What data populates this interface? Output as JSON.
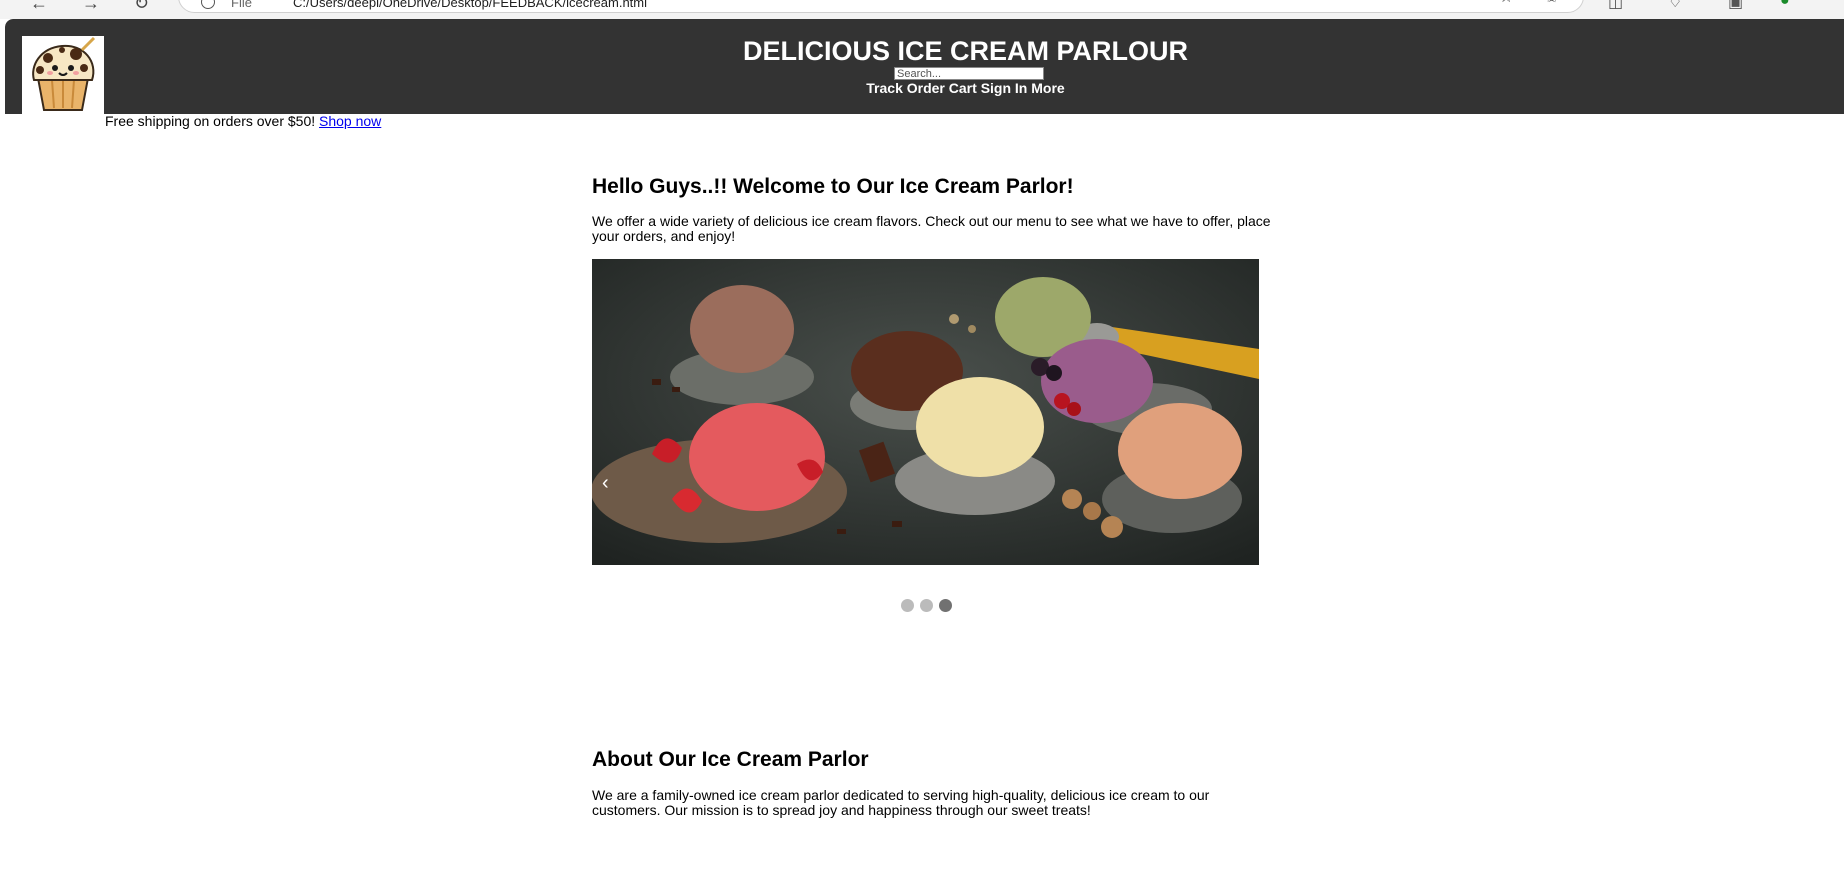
{
  "browser": {
    "address_scheme": "File",
    "address_url": "C:/Users/deepi/OneDrive/Desktop/FEEDBACK/icecream.html",
    "icons": [
      "back-icon",
      "forward-icon",
      "refresh-icon",
      "site-info-icon",
      "zoom-icon",
      "favorite-star-icon",
      "favorites-icon",
      "split-screen-icon",
      "collections-icon",
      "extensions-icon",
      "profile-icon"
    ]
  },
  "header": {
    "title": "DELICIOUS ICE CREAM PARLOUR",
    "search_placeholder": "Search...",
    "nav": [
      "Track Order",
      "Cart",
      "Sign In",
      "More"
    ],
    "background": "#333333"
  },
  "promo": {
    "text": "Free shipping on orders over $50! ",
    "link": "Shop now"
  },
  "welcome": {
    "title": "Hello Guys..!! Welcome to Our Ice Cream Parlor!",
    "text": "We offer a wide variety of delicious ice cream flavors. Check out our menu to see what we have to offer, place your orders, and enjoy!"
  },
  "carousel": {
    "prev_label": "‹",
    "slide_count": 3,
    "active_index": 2
  },
  "about": {
    "title": "About Our Ice Cream Parlor",
    "text": "We are a family-owned ice cream parlor dedicated to serving high-quality, delicious ice cream to our customers. Our mission is to spread joy and happiness through our sweet treats!"
  }
}
